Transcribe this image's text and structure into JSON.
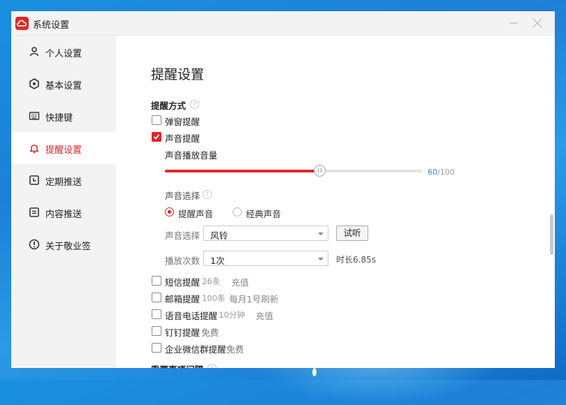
{
  "window": {
    "title": "系统设置"
  },
  "sidebar": {
    "items": [
      {
        "label": "个人设置",
        "icon": "user-icon"
      },
      {
        "label": "基本设置",
        "icon": "gear-icon"
      },
      {
        "label": "快捷键",
        "icon": "keyboard-icon"
      },
      {
        "label": "提醒设置",
        "icon": "bell-icon"
      },
      {
        "label": "定期推送",
        "icon": "clock-icon"
      },
      {
        "label": "内容推送",
        "icon": "document-icon"
      },
      {
        "label": "关于敬业签",
        "icon": "info-icon"
      }
    ],
    "active_index": 3
  },
  "main": {
    "title": "提醒设置",
    "reminder_method": {
      "heading": "提醒方式",
      "popup": {
        "label": "弹窗提醒",
        "checked": false
      },
      "sound": {
        "label": "声音提醒",
        "checked": true
      },
      "volume": {
        "label": "声音播放音量",
        "value": 60,
        "max": 100,
        "value_text": "60",
        "max_text": "/100"
      },
      "sound_choice": {
        "heading": "声音选择",
        "options": [
          {
            "label": "提醒声音",
            "selected": true
          },
          {
            "label": "经典声音",
            "selected": false
          }
        ],
        "select_label": "声音选择",
        "select_value": "风铃",
        "test_button": "试听",
        "play_count_label": "播放次数",
        "play_count_value": "1次",
        "duration_text": "时长6.85s"
      },
      "others": [
        {
          "label": "短信提醒",
          "note": "26条",
          "extra": "充值"
        },
        {
          "label": "邮箱提醒",
          "note": "100条",
          "extra": "每月1号刷新"
        },
        {
          "label": "语音电话提醒",
          "note": "10分钟",
          "extra": "充值"
        },
        {
          "label": "钉钉提醒",
          "note": "免费",
          "extra": ""
        },
        {
          "label": "企业微信群提醒",
          "note": "免费",
          "extra": ""
        }
      ]
    },
    "next_heading": "重要事项间隔"
  },
  "colors": {
    "accent": "#d9262c",
    "link": "#2a8bd8"
  }
}
